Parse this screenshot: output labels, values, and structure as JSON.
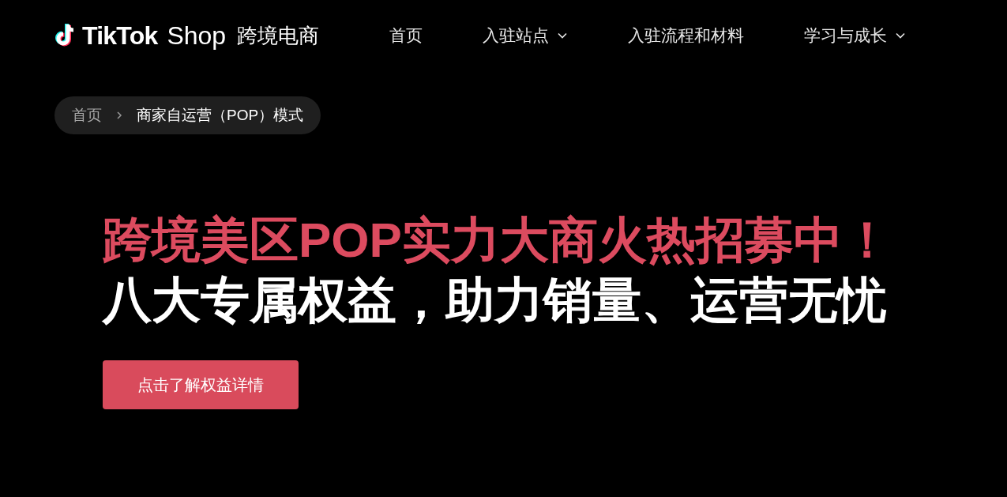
{
  "header": {
    "logo": {
      "brand": "TikTok",
      "product": "Shop",
      "tagline": "跨境电商"
    },
    "nav": [
      {
        "label": "首页",
        "has_menu": false
      },
      {
        "label": "入驻站点",
        "has_menu": true
      },
      {
        "label": "入驻流程和材料",
        "has_menu": false
      },
      {
        "label": "学习与成长",
        "has_menu": true
      }
    ]
  },
  "breadcrumb": [
    {
      "label": "首页",
      "current": false
    },
    {
      "label": "商家自运营（POP）模式",
      "current": true
    }
  ],
  "hero": {
    "headline": "跨境美区POP实力大商火热招募中！",
    "subheadline": "八大专属权益，助力销量、运营无忧",
    "button": "点击了解权益详情"
  }
}
